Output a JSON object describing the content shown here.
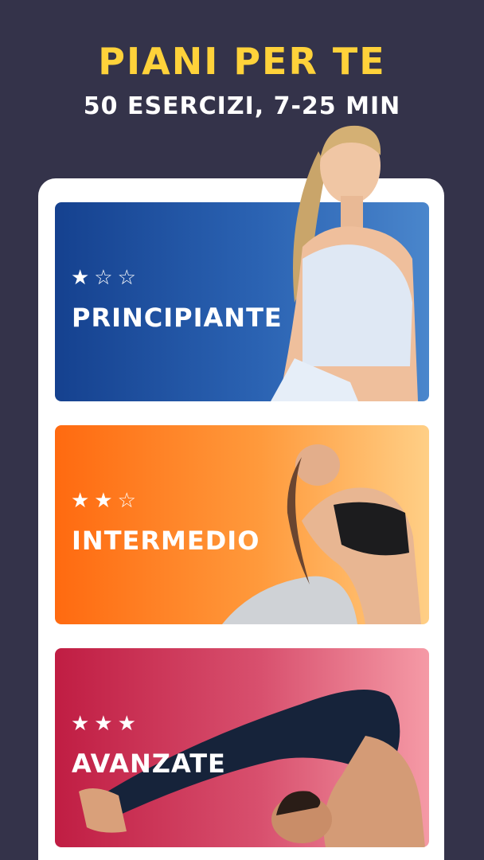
{
  "header": {
    "title": "PIANI PER TE",
    "subtitle": "50 ESERCIZI, 7-25 MIN"
  },
  "plans": [
    {
      "stars": "★☆☆",
      "label": "PRINCIPIANTE"
    },
    {
      "stars": "★★☆",
      "label": "INTERMEDIO"
    },
    {
      "stars": "★★★",
      "label": "AVANZATE"
    }
  ],
  "colors": {
    "background": "#34334a",
    "headline": "#ffd23a",
    "beginner": "#1f4f9f",
    "intermediate": "#ff8a2a",
    "advanced": "#d2405e"
  }
}
